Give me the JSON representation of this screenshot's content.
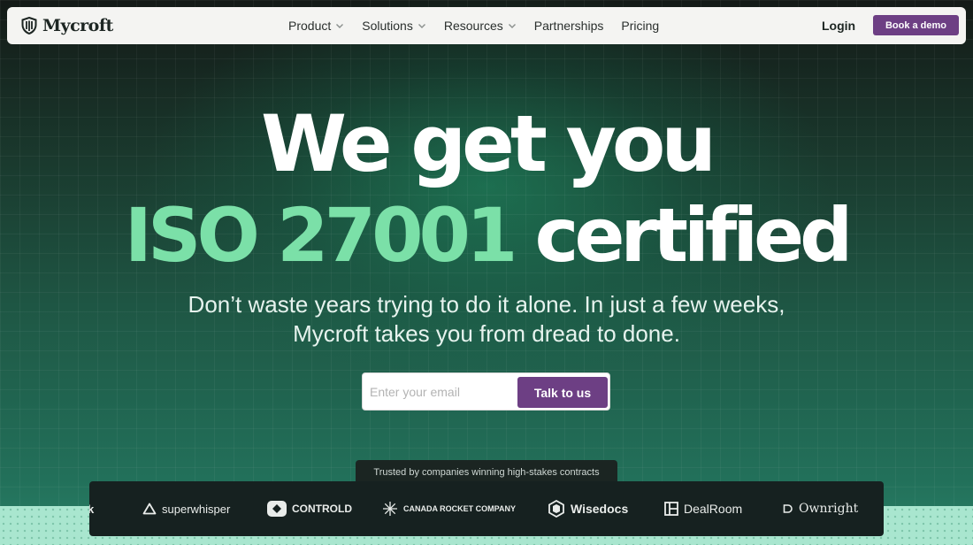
{
  "nav": {
    "brand": "Mycroft",
    "links": [
      {
        "label": "Product"
      },
      {
        "label": "Solutions"
      },
      {
        "label": "Resources"
      },
      {
        "label": "Partnerships"
      },
      {
        "label": "Pricing"
      }
    ],
    "login": "Login",
    "cta": "Book a demo"
  },
  "hero": {
    "line1": "We get you",
    "line2_accent": "ISO 27001",
    "line2_rest": "certified",
    "subtitle_line1": "Don’t waste years trying to do it alone. In just a few weeks,",
    "subtitle_line2": "Mycroft takes you from dread to done.",
    "email_placeholder": "Enter your email",
    "submit": "Talk to us"
  },
  "trusted": {
    "label": "Trusted by companies winning high-stakes contracts",
    "logos": [
      {
        "name": "k",
        "icon": "partial-logo"
      },
      {
        "name": "superwhisper",
        "icon": "triangle-icon"
      },
      {
        "name": "CONTROLD",
        "icon": "controld-icon"
      },
      {
        "name": "CANADA ROCKET COMPANY",
        "icon": "starburst-icon"
      },
      {
        "name": "Wisedocs",
        "icon": "cube-icon"
      },
      {
        "name": "DealRoom",
        "icon": "grid-square-icon"
      },
      {
        "name": "Ownright",
        "icon": "d-outline-icon"
      }
    ]
  },
  "colors": {
    "accent_purple": "#6d3f84",
    "accent_green": "#7be0a8",
    "nav_bg": "#f4f4f2",
    "logo_bar_bg": "#162120"
  }
}
